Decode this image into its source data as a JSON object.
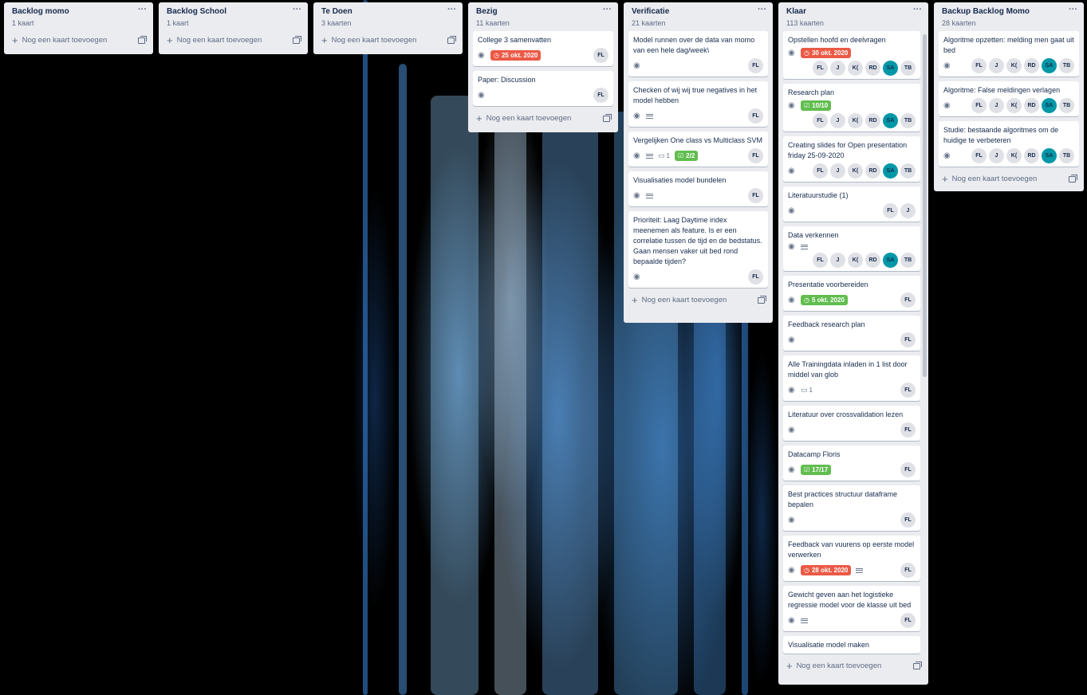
{
  "add_label": "Nog een kaart toevoegen",
  "lists": {
    "backlog_momo": {
      "title": "Backlog momo",
      "count": "1 kaart"
    },
    "backlog_school": {
      "title": "Backlog School",
      "count": "1 kaart"
    },
    "te_doen": {
      "title": "Te Doen",
      "count": "3 kaarten"
    },
    "bezig": {
      "title": "Bezig",
      "count": "11 kaarten",
      "cards": [
        {
          "title": "College 3 samenvatten",
          "due": "25 okt. 2020",
          "members": [
            "FL"
          ]
        },
        {
          "title": "Paper: Discussion",
          "members": [
            "FL"
          ]
        }
      ]
    },
    "verificatie": {
      "title": "Verificatie",
      "count": "21 kaarten",
      "cards": [
        {
          "title": "Model runnen over de data van momo van een hele dag/week\\",
          "members": [
            "FL"
          ]
        },
        {
          "title": "Checken of wij wij true negatives in het model hebben",
          "members": [
            "FL"
          ]
        },
        {
          "title": "Vergelijken One class vs Multiclass SVM",
          "comments": "1",
          "checklist": "2/2",
          "members": [
            "FL"
          ]
        },
        {
          "title": "Visualisaties model bundelen",
          "members": [
            "FL"
          ]
        },
        {
          "title": "Prioriteit: Laag Daytime index meenemen als feature. Is er een correlatie tussen de tijd en de bedstatus. Gaan mensen vaker uit bed rond bepaalde tijden?",
          "members": [
            "FL"
          ]
        }
      ]
    },
    "klaar": {
      "title": "Klaar",
      "count": "113 kaarten",
      "cards": [
        {
          "title": "Opstellen hoofd en deelvragen",
          "due": "30 okt. 2020",
          "members": [
            "FL",
            "J",
            "K(",
            "RD",
            "SA",
            "TB"
          ]
        },
        {
          "title": "Research plan",
          "checklist": "10/10",
          "members": [
            "FL",
            "J",
            "K(",
            "RD",
            "SA",
            "TB"
          ]
        },
        {
          "title": "Creating slides for Open presentation friday 25-09-2020",
          "members": [
            "FL",
            "J",
            "K(",
            "RD",
            "SA",
            "TB"
          ]
        },
        {
          "title": "Literatuurstudie (1)",
          "members": [
            "FL",
            "J"
          ]
        },
        {
          "title": "Data verkennen",
          "members": [
            "FL",
            "J",
            "K(",
            "RD",
            "SA",
            "TB"
          ]
        },
        {
          "title": "Presentatie voorbereiden",
          "due_done": "5 okt. 2020",
          "members": [
            "FL"
          ]
        },
        {
          "title": "Feedback research plan",
          "members": [
            "FL"
          ]
        },
        {
          "title": "Alle Trainingdata inladen in 1 list door middel van glob",
          "comments": "1",
          "members": [
            "FL"
          ]
        },
        {
          "title": "Literatuur over crossvalidation lezen",
          "members": [
            "FL"
          ]
        },
        {
          "title": "Datacamp Floris",
          "checklist": "17/17",
          "members": [
            "FL"
          ]
        },
        {
          "title": "Best practices structuur dataframe bepalen",
          "members": [
            "FL"
          ]
        },
        {
          "title": "Feedback van vuurens op eerste model verwerken",
          "due": "28 okt. 2020",
          "members": [
            "FL"
          ]
        },
        {
          "title": "Gewicht geven aan het logistieke regressie model voor de klasse uit bed",
          "members": [
            "FL"
          ]
        },
        {
          "title": "Visualisatie model maken"
        }
      ]
    },
    "backup": {
      "title": "Backup Backlog Momo",
      "count": "28 kaarten",
      "cards": [
        {
          "title": "Algoritme opzetten: melding men gaat uit bed",
          "members": [
            "FL",
            "J",
            "K(",
            "RD",
            "SA",
            "TB"
          ]
        },
        {
          "title": "Algoritme: False meldingen verlagen",
          "members": [
            "FL",
            "J",
            "K(",
            "RD",
            "SA",
            "TB"
          ]
        },
        {
          "title": "Studie: bestaande algoritmes om de huidige te verbeteren",
          "members": [
            "FL",
            "J",
            "K(",
            "RD",
            "SA",
            "TB"
          ]
        }
      ]
    }
  },
  "colors": {
    "due_red": "#eb5a46",
    "done_green": "#61bd4f",
    "avatar_sa": "#0097a7",
    "list_bg": "#ebecf0"
  }
}
